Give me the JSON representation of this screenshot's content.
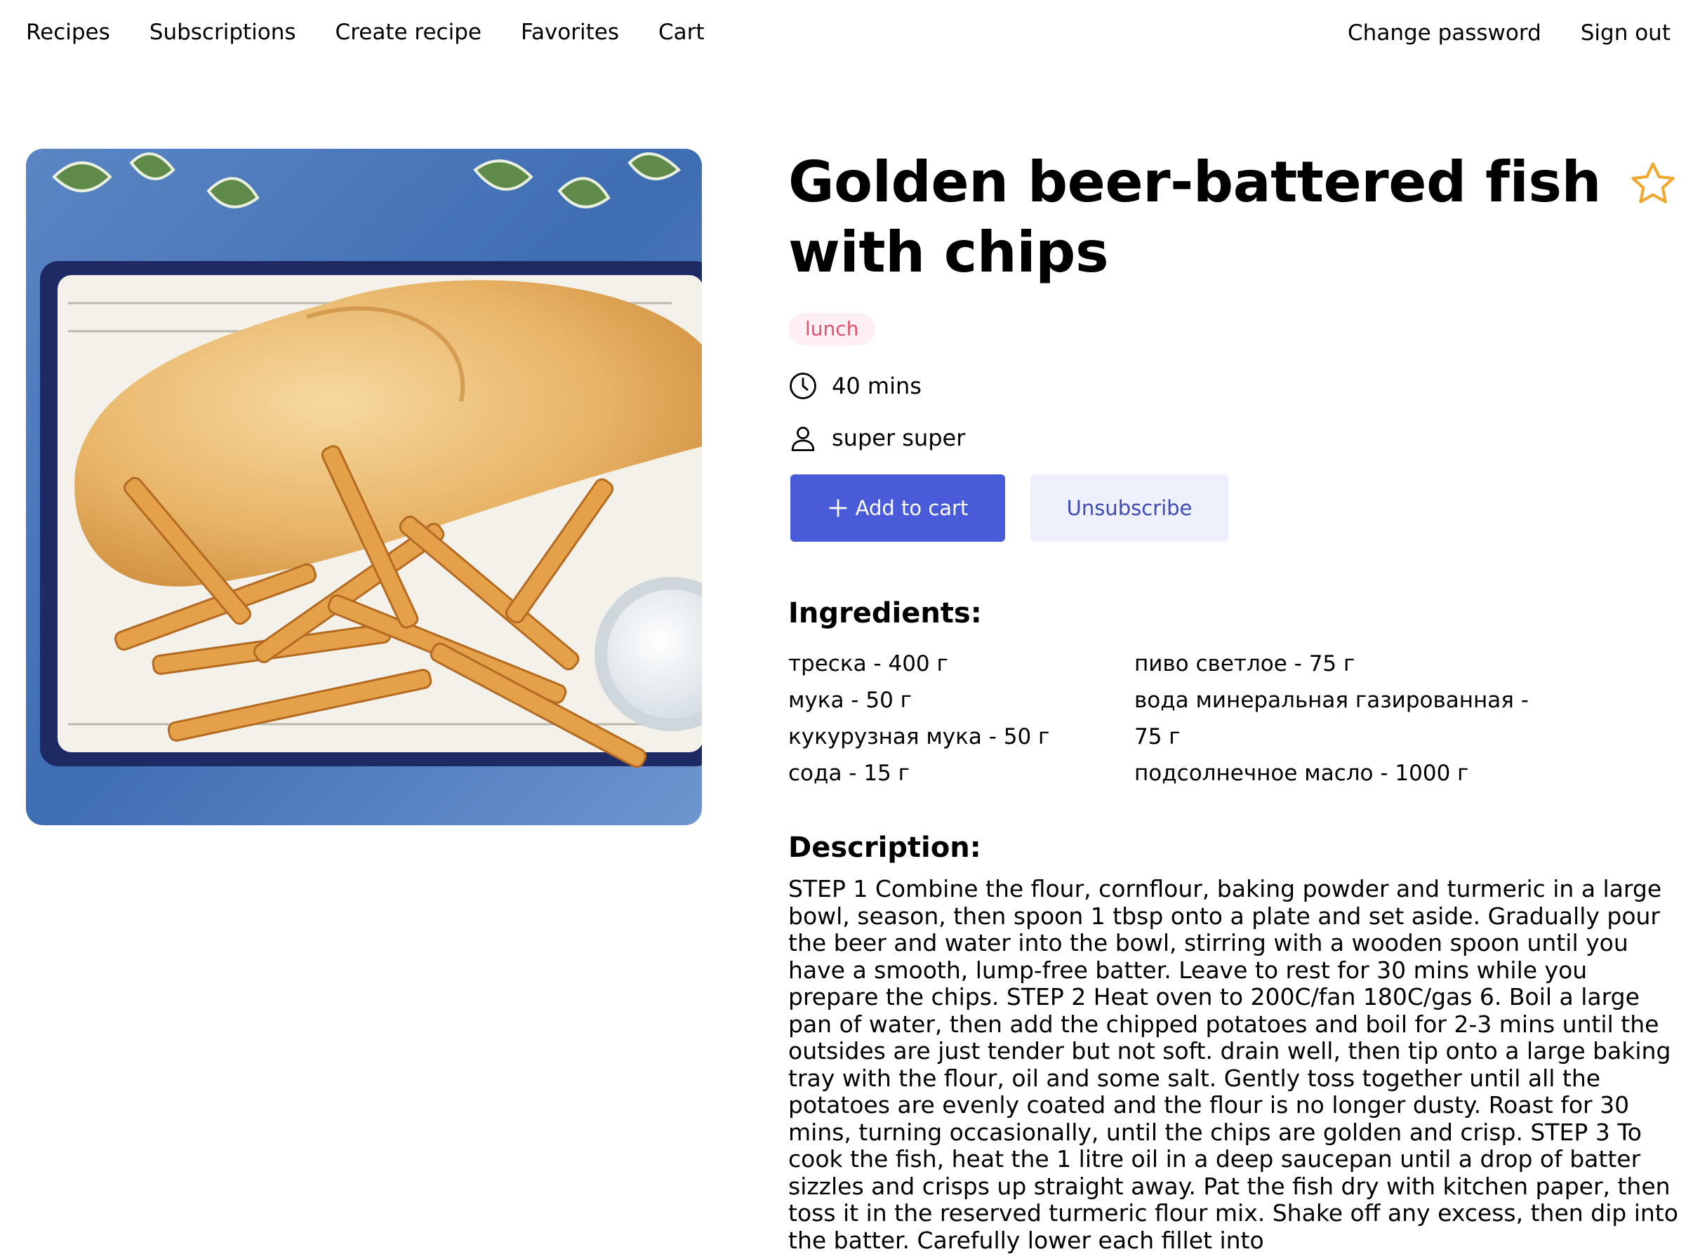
{
  "nav": {
    "left": [
      "Recipes",
      "Subscriptions",
      "Create recipe",
      "Favorites",
      "Cart"
    ],
    "right": [
      "Change password",
      "Sign out"
    ]
  },
  "recipe": {
    "title": "Golden beer-battered fish with chips",
    "tag": "lunch",
    "time": "40 mins",
    "author": "super super",
    "add_to_cart_label": "Add to cart",
    "unsubscribe_label": "Unsubscribe",
    "ingredients_heading": "Ingredients:",
    "ingredients_col1": [
      "треска - 400 г",
      "мука - 50 г",
      "кукурузная мука - 50 г",
      "сода - 15 г"
    ],
    "ingredients_col2": [
      "пиво светлое - 75 г",
      "вода минеральная газированная - 75 г",
      "подсолнечное масло - 1000 г"
    ],
    "description_heading": "Description:",
    "description": "STEP 1 Combine the flour, cornflour, baking powder and turmeric in a large bowl, season, then spoon 1 tbsp onto a plate and set aside. Gradually pour the beer and water into the bowl, stirring with a wooden spoon until you have a smooth, lump-free batter. Leave to rest for 30 mins while you prepare the chips. STEP 2 Heat oven to 200C/fan 180C/gas 6. Boil a large pan of water, then add the chipped potatoes and boil for 2-3 mins until the outsides are just tender but not soft. drain well, then tip onto a large baking tray with the flour, oil and some salt. Gently toss together until all the potatoes are evenly coated and the flour is no longer dusty. Roast for 30 mins, turning occasionally, until the chips are golden and crisp. STEP 3 To cook the fish, heat the 1 litre oil in a deep saucepan until a drop of batter sizzles and crisps up straight away. Pat the fish dry with kitchen paper, then toss it in the reserved turmeric flour mix. Shake off any excess, then dip into the batter. Carefully lower each fillet into"
  },
  "colors": {
    "accent": "#4a5bd9",
    "tag_bg": "#fdeff3",
    "tag_text": "#e0506f",
    "star": "#f0a830"
  },
  "icons": {
    "favorite": "star-outline-icon",
    "time": "clock-icon",
    "author": "user-icon",
    "add": "plus-icon"
  }
}
